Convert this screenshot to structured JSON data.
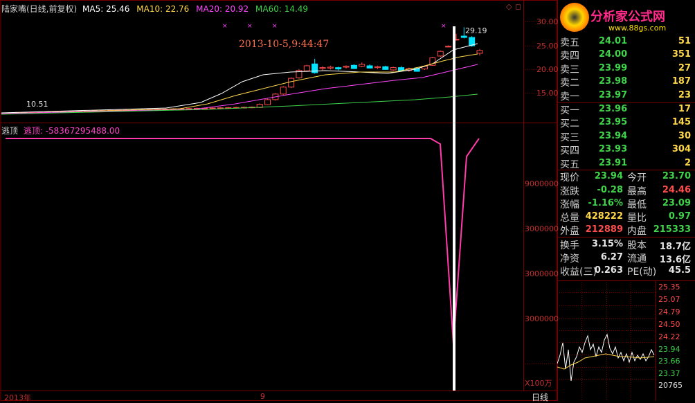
{
  "header": {
    "stock": "陆家嘴(日线,前复权)",
    "ma": [
      {
        "label": "MA5: 25.46",
        "color": "#ffffff"
      },
      {
        "label": "MA10: 22.76",
        "color": "#ffd84a"
      },
      {
        "label": "MA20: 20.92",
        "color": "#ff46ff"
      },
      {
        "label": "MA60: 14.49",
        "color": "#3fd34a"
      }
    ]
  },
  "crosshair": {
    "datetime": "2013-10-5,9:44:47",
    "price_label": "29.19",
    "low_label": "10.51"
  },
  "price_axis": [
    "30.00",
    "25.00",
    "20.00",
    "15.00"
  ],
  "indicator": {
    "name": "逃顶",
    "value_text": "逃顶: -58367295488.00",
    "ticks": [
      "9000000",
      "3000000",
      "3000000",
      "3000000"
    ]
  },
  "unit_label": "X100万",
  "bottom": {
    "year": "2013年",
    "month": "9",
    "period": "日线"
  },
  "logo": {
    "title": "分析家公式网",
    "url": "www.88gs.com"
  },
  "order_book": {
    "sell": [
      {
        "label": "卖五",
        "price": "24.01",
        "vol": "51"
      },
      {
        "label": "卖四",
        "price": "24.00",
        "vol": "351"
      },
      {
        "label": "卖三",
        "price": "23.99",
        "vol": "27"
      },
      {
        "label": "卖二",
        "price": "23.98",
        "vol": "187"
      },
      {
        "label": "卖一",
        "price": "23.97",
        "vol": "23"
      }
    ],
    "buy": [
      {
        "label": "买一",
        "price": "23.96",
        "vol": "17"
      },
      {
        "label": "买二",
        "price": "23.95",
        "vol": "145"
      },
      {
        "label": "买三",
        "price": "23.94",
        "vol": "30"
      },
      {
        "label": "买四",
        "price": "23.93",
        "vol": "304"
      },
      {
        "label": "买五",
        "price": "23.91",
        "vol": "2"
      }
    ]
  },
  "quote": {
    "r1": {
      "l1": "现价",
      "v1": "23.94",
      "l2": "今开",
      "v2": "23.70"
    },
    "r2": {
      "l1": "涨跌",
      "v1": "-0.28",
      "l2": "最高",
      "v2": "24.46"
    },
    "r3": {
      "l1": "涨幅",
      "v1": "-1.16%",
      "l2": "最低",
      "v2": "23.09"
    },
    "r4": {
      "l1": "总量",
      "v1": "428222",
      "l2": "量比",
      "v2": "0.97"
    },
    "r5": {
      "l1": "外盘",
      "v1": "212889",
      "l2": "内盘",
      "v2": "215333"
    },
    "r6": {
      "l1": "换手",
      "v1": "3.15%",
      "l2": "股本",
      "v2": "18.7亿"
    },
    "r7": {
      "l1": "净资",
      "v1": "6.27",
      "l2": "流通",
      "v2": "13.6亿"
    },
    "r8": {
      "l1": "收益(三)",
      "v1": "0.263",
      "l2": "PE(动)",
      "v2": "45.5"
    }
  },
  "mini_axis": [
    "25.35",
    "25.07",
    "24.79",
    "24.50",
    "24.22",
    "23.94",
    "23.66",
    "23.37",
    "20765"
  ],
  "colors": {
    "up": "#ff4c4c",
    "down": "#00e4ff",
    "grid": "#7a0000",
    "ma5": "#ffffff",
    "ma10": "#ffd84a",
    "ma20": "#ff46ff",
    "ma60": "#3fd34a",
    "indicator": "#ff3ca8"
  }
}
